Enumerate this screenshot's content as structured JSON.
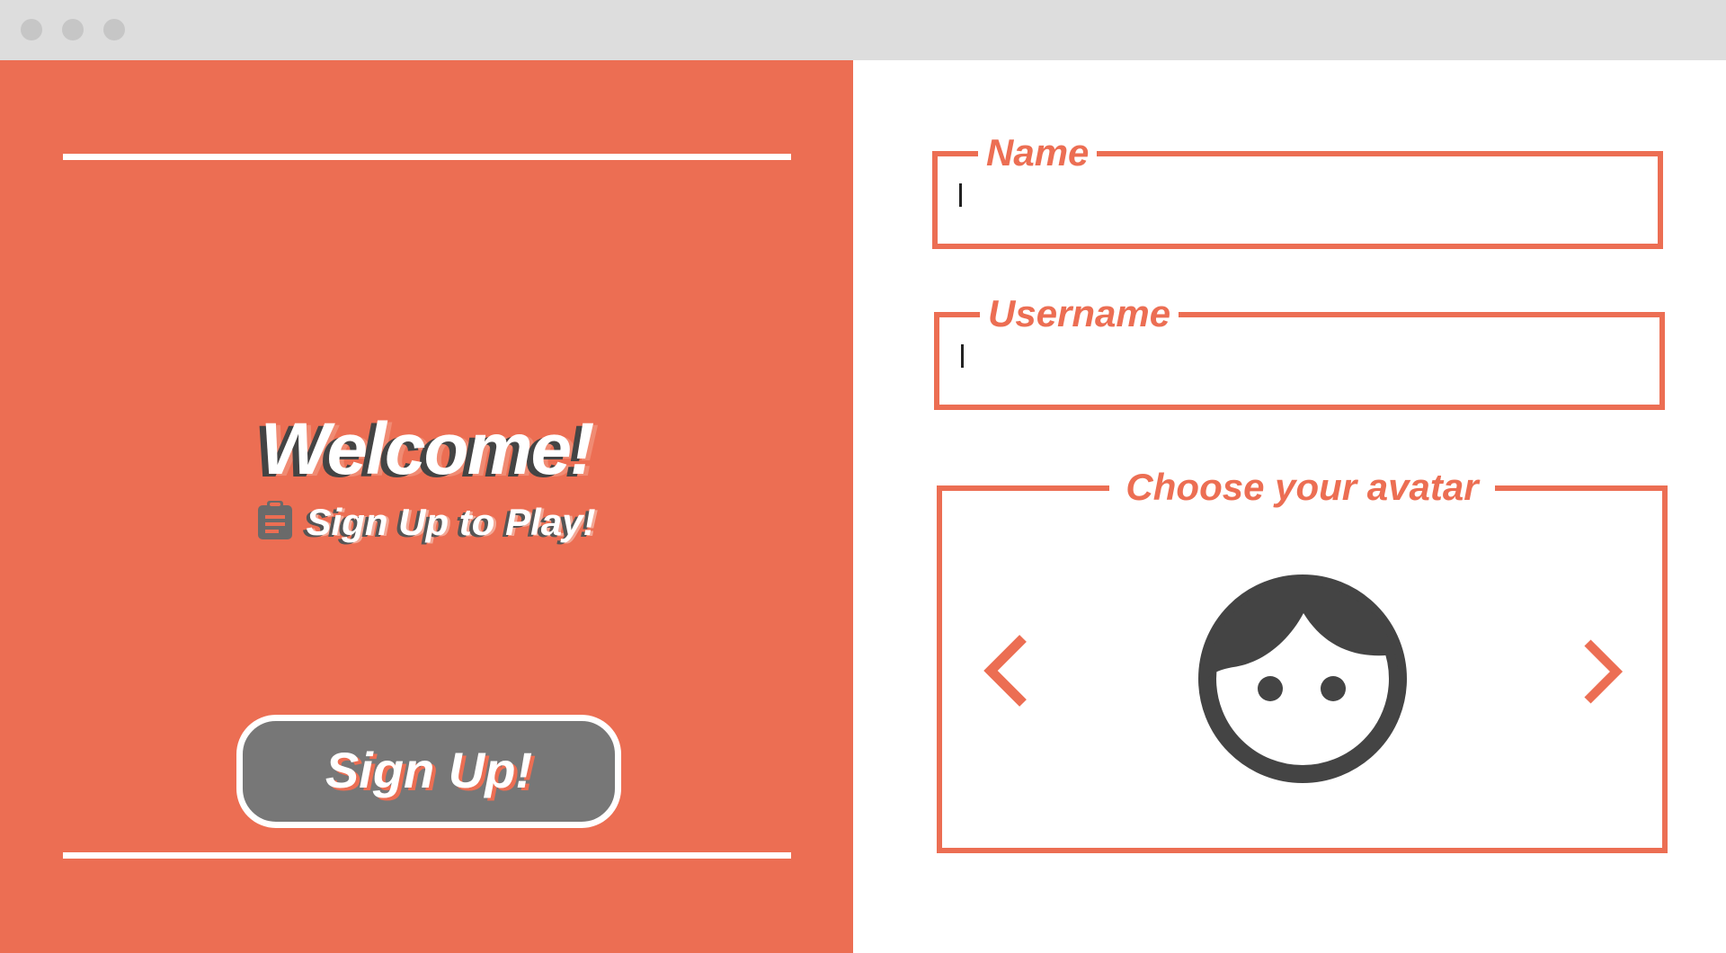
{
  "left": {
    "title": "Welcome!",
    "subtitle": "Sign Up to Play!",
    "subtitle_icon": "clipboard-icon",
    "signup_button": "Sign Up!"
  },
  "form": {
    "name_label": "Name",
    "name_value": "",
    "username_label": "Username",
    "username_value": "",
    "avatar_label": "Choose your avatar",
    "avatar_icon": "face-icon",
    "prev_icon": "chevron-left-icon",
    "next_icon": "chevron-right-icon"
  },
  "colors": {
    "accent": "#ec6e53",
    "button": "#777777",
    "avatar": "#444444",
    "titlebar": "#dddddd"
  }
}
